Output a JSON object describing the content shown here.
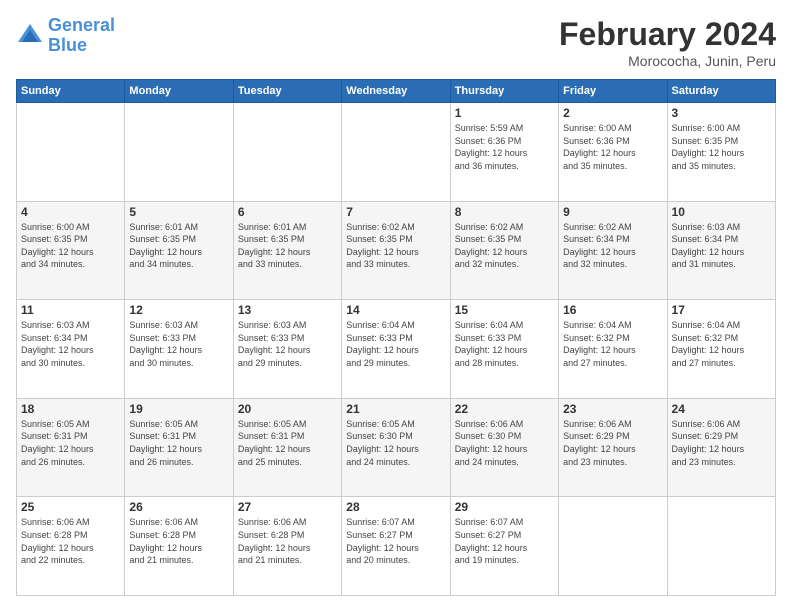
{
  "header": {
    "logo_line1": "General",
    "logo_line2": "Blue",
    "main_title": "February 2024",
    "sub_title": "Morococha, Junin, Peru"
  },
  "calendar": {
    "days_of_week": [
      "Sunday",
      "Monday",
      "Tuesday",
      "Wednesday",
      "Thursday",
      "Friday",
      "Saturday"
    ],
    "weeks": [
      [
        {
          "day": "",
          "info": ""
        },
        {
          "day": "",
          "info": ""
        },
        {
          "day": "",
          "info": ""
        },
        {
          "day": "",
          "info": ""
        },
        {
          "day": "1",
          "info": "Sunrise: 5:59 AM\nSunset: 6:36 PM\nDaylight: 12 hours\nand 36 minutes."
        },
        {
          "day": "2",
          "info": "Sunrise: 6:00 AM\nSunset: 6:36 PM\nDaylight: 12 hours\nand 35 minutes."
        },
        {
          "day": "3",
          "info": "Sunrise: 6:00 AM\nSunset: 6:35 PM\nDaylight: 12 hours\nand 35 minutes."
        }
      ],
      [
        {
          "day": "4",
          "info": "Sunrise: 6:00 AM\nSunset: 6:35 PM\nDaylight: 12 hours\nand 34 minutes."
        },
        {
          "day": "5",
          "info": "Sunrise: 6:01 AM\nSunset: 6:35 PM\nDaylight: 12 hours\nand 34 minutes."
        },
        {
          "day": "6",
          "info": "Sunrise: 6:01 AM\nSunset: 6:35 PM\nDaylight: 12 hours\nand 33 minutes."
        },
        {
          "day": "7",
          "info": "Sunrise: 6:02 AM\nSunset: 6:35 PM\nDaylight: 12 hours\nand 33 minutes."
        },
        {
          "day": "8",
          "info": "Sunrise: 6:02 AM\nSunset: 6:35 PM\nDaylight: 12 hours\nand 32 minutes."
        },
        {
          "day": "9",
          "info": "Sunrise: 6:02 AM\nSunset: 6:34 PM\nDaylight: 12 hours\nand 32 minutes."
        },
        {
          "day": "10",
          "info": "Sunrise: 6:03 AM\nSunset: 6:34 PM\nDaylight: 12 hours\nand 31 minutes."
        }
      ],
      [
        {
          "day": "11",
          "info": "Sunrise: 6:03 AM\nSunset: 6:34 PM\nDaylight: 12 hours\nand 30 minutes."
        },
        {
          "day": "12",
          "info": "Sunrise: 6:03 AM\nSunset: 6:33 PM\nDaylight: 12 hours\nand 30 minutes."
        },
        {
          "day": "13",
          "info": "Sunrise: 6:03 AM\nSunset: 6:33 PM\nDaylight: 12 hours\nand 29 minutes."
        },
        {
          "day": "14",
          "info": "Sunrise: 6:04 AM\nSunset: 6:33 PM\nDaylight: 12 hours\nand 29 minutes."
        },
        {
          "day": "15",
          "info": "Sunrise: 6:04 AM\nSunset: 6:33 PM\nDaylight: 12 hours\nand 28 minutes."
        },
        {
          "day": "16",
          "info": "Sunrise: 6:04 AM\nSunset: 6:32 PM\nDaylight: 12 hours\nand 27 minutes."
        },
        {
          "day": "17",
          "info": "Sunrise: 6:04 AM\nSunset: 6:32 PM\nDaylight: 12 hours\nand 27 minutes."
        }
      ],
      [
        {
          "day": "18",
          "info": "Sunrise: 6:05 AM\nSunset: 6:31 PM\nDaylight: 12 hours\nand 26 minutes."
        },
        {
          "day": "19",
          "info": "Sunrise: 6:05 AM\nSunset: 6:31 PM\nDaylight: 12 hours\nand 26 minutes."
        },
        {
          "day": "20",
          "info": "Sunrise: 6:05 AM\nSunset: 6:31 PM\nDaylight: 12 hours\nand 25 minutes."
        },
        {
          "day": "21",
          "info": "Sunrise: 6:05 AM\nSunset: 6:30 PM\nDaylight: 12 hours\nand 24 minutes."
        },
        {
          "day": "22",
          "info": "Sunrise: 6:06 AM\nSunset: 6:30 PM\nDaylight: 12 hours\nand 24 minutes."
        },
        {
          "day": "23",
          "info": "Sunrise: 6:06 AM\nSunset: 6:29 PM\nDaylight: 12 hours\nand 23 minutes."
        },
        {
          "day": "24",
          "info": "Sunrise: 6:06 AM\nSunset: 6:29 PM\nDaylight: 12 hours\nand 23 minutes."
        }
      ],
      [
        {
          "day": "25",
          "info": "Sunrise: 6:06 AM\nSunset: 6:28 PM\nDaylight: 12 hours\nand 22 minutes."
        },
        {
          "day": "26",
          "info": "Sunrise: 6:06 AM\nSunset: 6:28 PM\nDaylight: 12 hours\nand 21 minutes."
        },
        {
          "day": "27",
          "info": "Sunrise: 6:06 AM\nSunset: 6:28 PM\nDaylight: 12 hours\nand 21 minutes."
        },
        {
          "day": "28",
          "info": "Sunrise: 6:07 AM\nSunset: 6:27 PM\nDaylight: 12 hours\nand 20 minutes."
        },
        {
          "day": "29",
          "info": "Sunrise: 6:07 AM\nSunset: 6:27 PM\nDaylight: 12 hours\nand 19 minutes."
        },
        {
          "day": "",
          "info": ""
        },
        {
          "day": "",
          "info": ""
        }
      ]
    ]
  }
}
